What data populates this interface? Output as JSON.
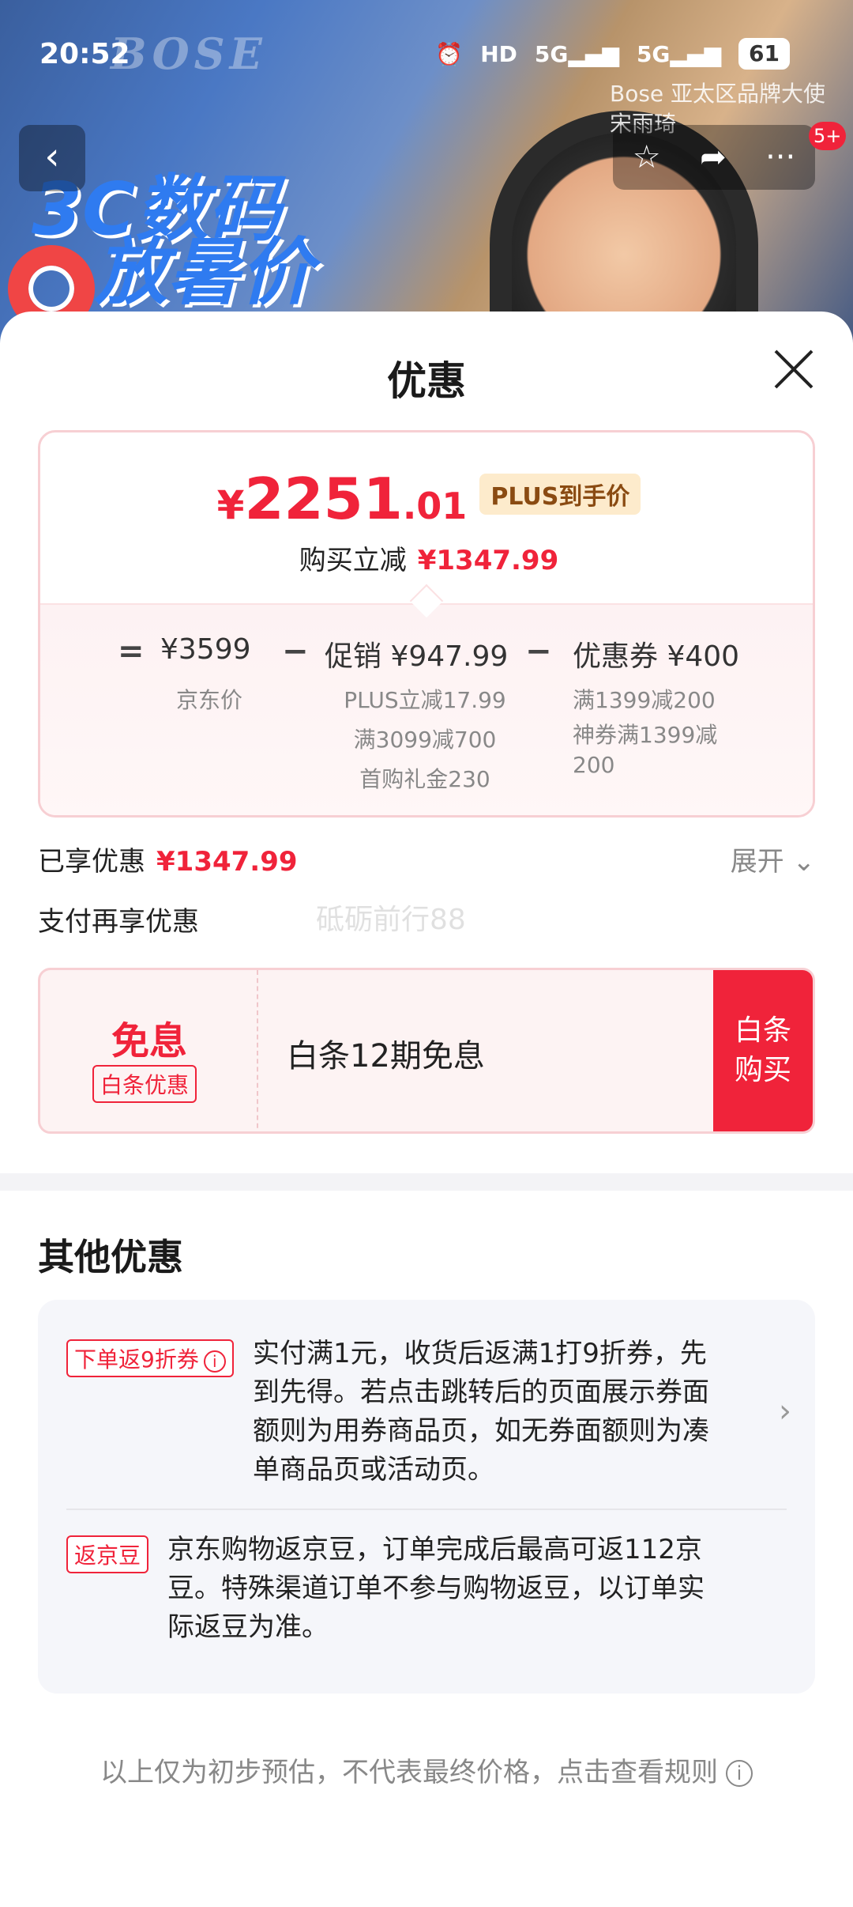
{
  "status_bar": {
    "time": "20:52",
    "hd": "HD",
    "net1": "5G",
    "net2": "5G",
    "battery": "61"
  },
  "hero": {
    "brand_watermark": "BOSE",
    "promo_line1": "3C数码",
    "promo_line2": "放暑价",
    "store_label": "Bose 亚太区品牌大使 宋雨琦"
  },
  "nav": {
    "back_icon": "chevron-left-icon",
    "actions": [
      "star-icon",
      "share-icon",
      "more-icon"
    ],
    "message_badge": "5+"
  },
  "sheet": {
    "title": "优惠",
    "price": {
      "currency": "¥",
      "integer": "2251",
      "decimal": ".01",
      "plus_tag": "PLUS到手价",
      "reduce_label": "购买立减",
      "reduce_value": "¥1347.99"
    },
    "formula": {
      "eq": "=",
      "jd_price": "¥3599",
      "jd_price_label": "京东价",
      "minus1": "−",
      "promo": "促销 ¥947.99",
      "promo_details": [
        "PLUS立减17.99",
        "满3099减700",
        "首购礼金230"
      ],
      "minus2": "−",
      "coupon": "优惠券 ¥400",
      "coupon_details": [
        "满1399减200",
        "神券满1399减",
        "200"
      ]
    },
    "enjoyed_label": "已享优惠",
    "enjoyed_value": "¥1347.99",
    "expand_label": "展开",
    "pay_again_label": "支付再享优惠",
    "watermark": "砥砺前行88",
    "baitiao": {
      "title": "免息",
      "tag": "白条优惠",
      "desc": "白条12期免息",
      "buy_label_line1": "白条",
      "buy_label_line2": "购买"
    },
    "other_title": "其他优惠",
    "other_items": [
      {
        "tag": "下单返9折券",
        "text_lines": [
          "实付满1元，收货后返满1打9折券，先",
          "到先得。若点击跳转后的页面展示券面",
          "额则为用券商品页，如无券面额则为凑",
          "单商品页或活动页。"
        ]
      },
      {
        "tag": "返京豆",
        "text_lines": [
          "京东购物返京豆，订单完成后最高可返112京",
          "豆。特殊渠道订单不参与购物返豆，以订单实",
          "际返豆为准。"
        ]
      }
    ],
    "footnote": "以上仅为初步预估，不代表最终价格，点击查看规则"
  },
  "colors": {
    "accent_red": "#f0233a",
    "plus_tag_bg": "#fdebcc",
    "plus_tag_text": "#8a4b12"
  }
}
